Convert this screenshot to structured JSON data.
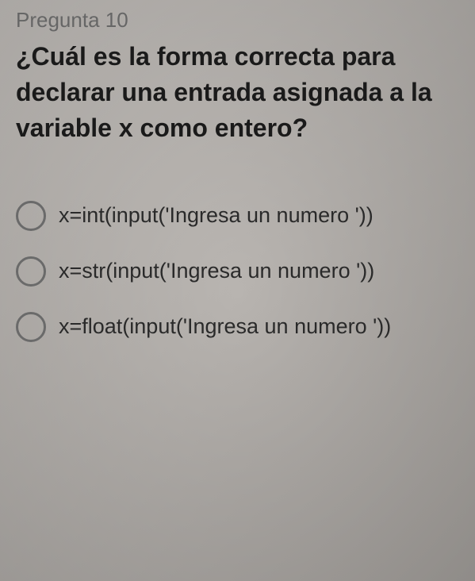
{
  "question": {
    "number": "Pregunta 10",
    "text": "¿Cuál es la forma correcta para declarar una entrada asignada a la variable x como entero?"
  },
  "options": [
    {
      "text": "x=int(input('Ingresa un numero '))"
    },
    {
      "text": "x=str(input('Ingresa un numero '))"
    },
    {
      "text": "x=float(input('Ingresa un numero '))"
    }
  ]
}
